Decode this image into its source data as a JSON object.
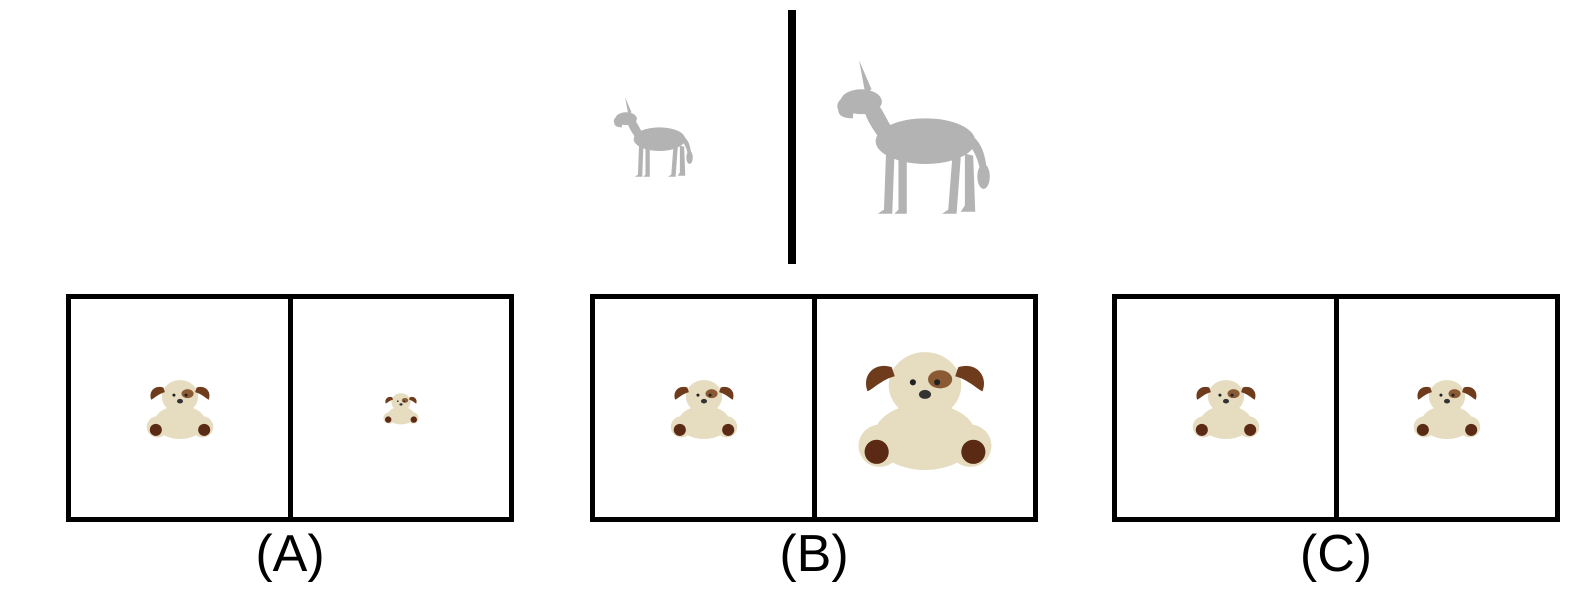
{
  "colors": {
    "frame": "#000000",
    "donkey": "#b3b3b3",
    "bear_fur": "#e6dcc0",
    "bear_ear": "#6e3c1c",
    "bear_paw": "#5a2a14"
  },
  "icons": {
    "donkey": "donkey-icon",
    "bear": "teddy-bear-icon"
  },
  "panels": [
    {
      "label": "(A)",
      "left_size": "medium",
      "right_size": "small"
    },
    {
      "label": "(B)",
      "left_size": "medium",
      "right_size": "large"
    },
    {
      "label": "(C)",
      "left_size": "medium",
      "right_size": "medium"
    }
  ]
}
